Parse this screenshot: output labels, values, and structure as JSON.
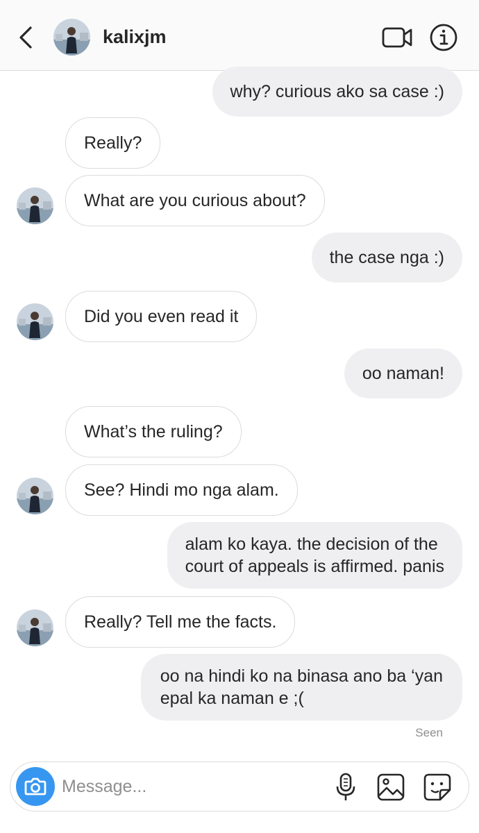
{
  "header": {
    "username": "kalixjm"
  },
  "messages": [
    {
      "from": "me",
      "text": "why? curious ako sa case :)"
    },
    {
      "from": "them",
      "text": "Really?"
    },
    {
      "from": "them",
      "text": "What are you curious about?"
    },
    {
      "from": "me",
      "text": "the case nga :)"
    },
    {
      "from": "them",
      "text": "Did you even read it"
    },
    {
      "from": "me",
      "text": "oo naman!"
    },
    {
      "from": "them",
      "text": "What’s the ruling?"
    },
    {
      "from": "them",
      "text": "See? Hindi mo nga alam."
    },
    {
      "from": "me",
      "text": "alam ko kaya. the decision of the\ncourt of appeals is affirmed. panis"
    },
    {
      "from": "them",
      "text": "Really? Tell me the facts."
    },
    {
      "from": "me",
      "text": "oo na hindi ko na binasa ano ba ‘yan\nepal ka naman e ;("
    }
  ],
  "status": {
    "seen": "Seen"
  },
  "composer": {
    "placeholder": "Message...",
    "icons": [
      "camera-icon",
      "microphone-icon",
      "gallery-icon",
      "sticker-icon"
    ]
  },
  "colors": {
    "accent": "#3797f0",
    "sent_bubble": "#efeff1",
    "received_border": "#dbdbdb",
    "muted_text": "#8e8e8e"
  }
}
